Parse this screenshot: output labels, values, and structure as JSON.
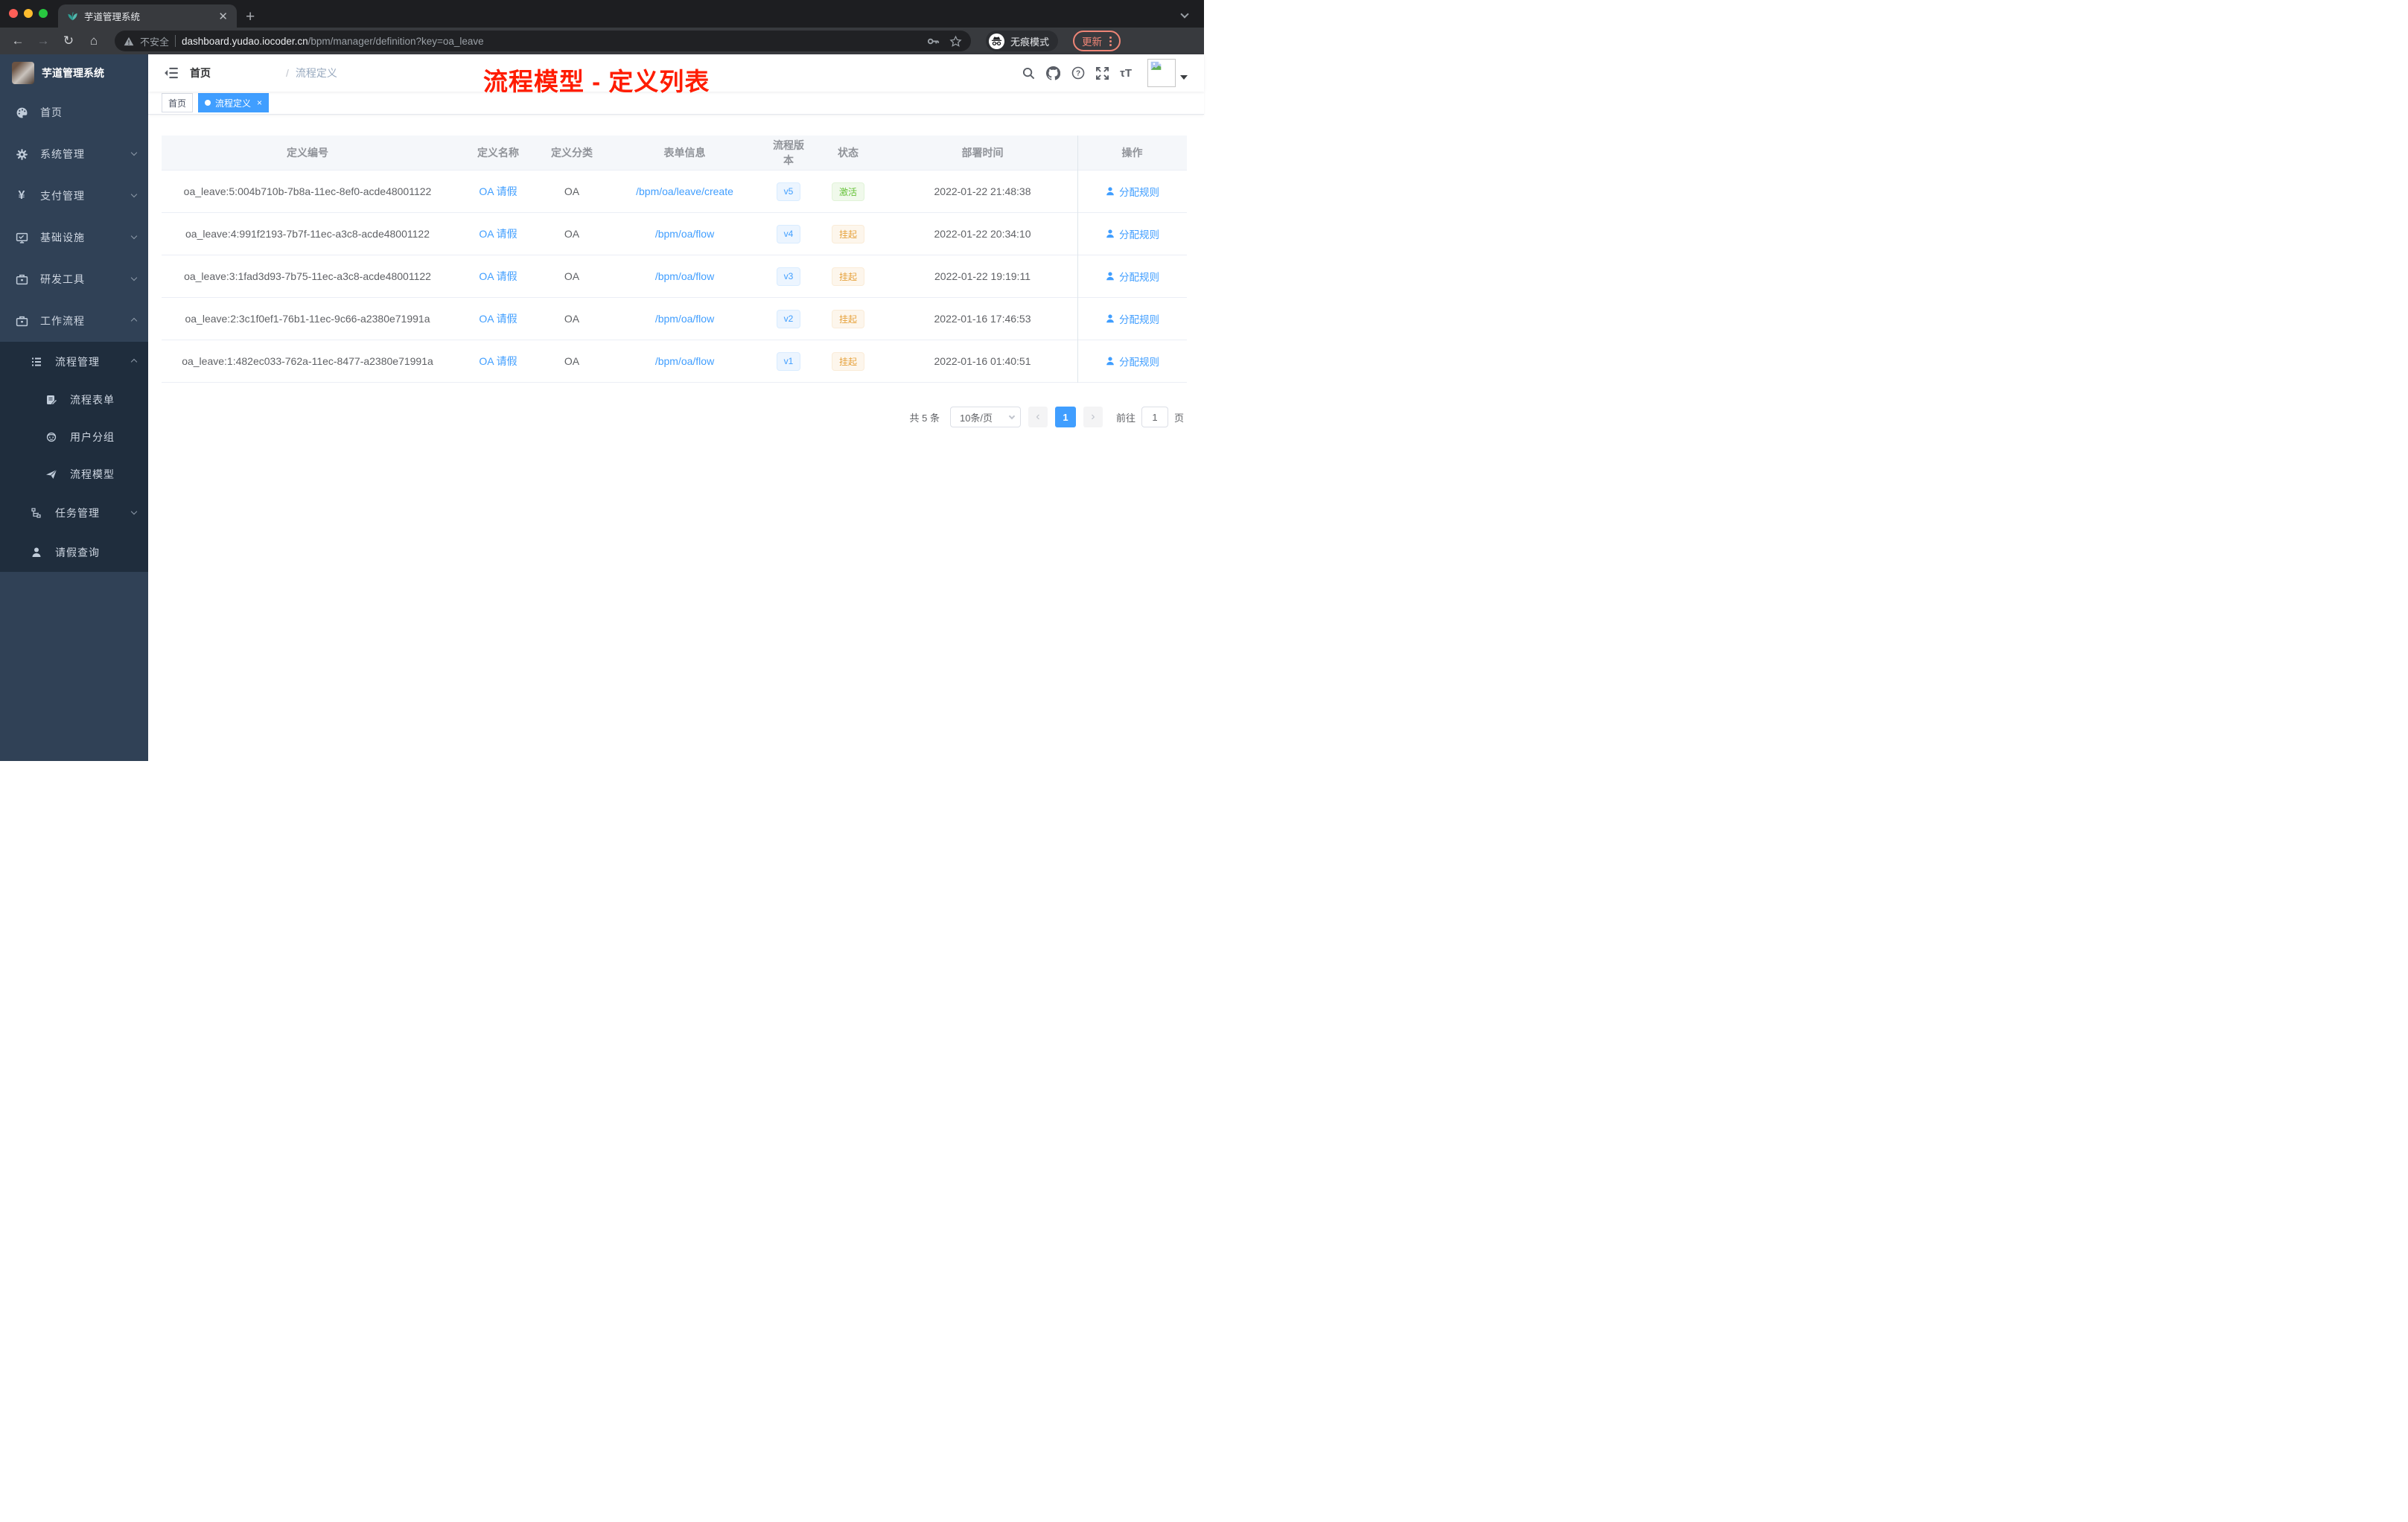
{
  "browser": {
    "tab_title": "芋道管理系统",
    "security_label": "不安全",
    "url_host": "dashboard.yudao.iocoder.cn",
    "url_path": "/bpm/manager/definition?key=oa_leave",
    "incognito_label": "无痕模式",
    "update_label": "更新"
  },
  "sidebar": {
    "logo_title": "芋道管理系统",
    "items": [
      {
        "label": "首页"
      },
      {
        "label": "系统管理"
      },
      {
        "label": "支付管理"
      },
      {
        "label": "基础设施"
      },
      {
        "label": "研发工具"
      },
      {
        "label": "工作流程"
      }
    ],
    "submenu": [
      {
        "label": "流程管理"
      },
      {
        "label": "流程表单"
      },
      {
        "label": "用户分组"
      },
      {
        "label": "流程模型"
      },
      {
        "label": "任务管理"
      },
      {
        "label": "请假查询"
      }
    ]
  },
  "navbar": {
    "breadcrumb": [
      "首页",
      "流程定义"
    ],
    "annotation": "流程模型 - 定义列表"
  },
  "tags": {
    "inactive": "首页",
    "active": "流程定义",
    "close": "×"
  },
  "table": {
    "headers": [
      "定义编号",
      "定义名称",
      "定义分类",
      "表单信息",
      "流程版本",
      "状态",
      "部署时间",
      "操作"
    ],
    "rows": [
      {
        "id": "oa_leave:5:004b710b-7b8a-11ec-8ef0-acde48001122",
        "name": "OA 请假",
        "category": "OA",
        "form": "/bpm/oa/leave/create",
        "version": "v5",
        "status": "激活",
        "status_type": "success",
        "time": "2022-01-22 21:48:38",
        "action": "分配规则"
      },
      {
        "id": "oa_leave:4:991f2193-7b7f-11ec-a3c8-acde48001122",
        "name": "OA 请假",
        "category": "OA",
        "form": "/bpm/oa/flow",
        "version": "v4",
        "status": "挂起",
        "status_type": "warning",
        "time": "2022-01-22 20:34:10",
        "action": "分配规则"
      },
      {
        "id": "oa_leave:3:1fad3d93-7b75-11ec-a3c8-acde48001122",
        "name": "OA 请假",
        "category": "OA",
        "form": "/bpm/oa/flow",
        "version": "v3",
        "status": "挂起",
        "status_type": "warning",
        "time": "2022-01-22 19:19:11",
        "action": "分配规则"
      },
      {
        "id": "oa_leave:2:3c1f0ef1-76b1-11ec-9c66-a2380e71991a",
        "name": "OA 请假",
        "category": "OA",
        "form": "/bpm/oa/flow",
        "version": "v2",
        "status": "挂起",
        "status_type": "warning",
        "time": "2022-01-16 17:46:53",
        "action": "分配规则"
      },
      {
        "id": "oa_leave:1:482ec033-762a-11ec-8477-a2380e71991a",
        "name": "OA 请假",
        "category": "OA",
        "form": "/bpm/oa/flow",
        "version": "v1",
        "status": "挂起",
        "status_type": "warning",
        "time": "2022-01-16 01:40:51",
        "action": "分配规则"
      }
    ]
  },
  "pagination": {
    "total": "共 5 条",
    "page_size": "10条/页",
    "prev": "‹",
    "current_page": "1",
    "next": "›",
    "goto_label": "前往",
    "goto_value": "1",
    "page_label": "页"
  },
  "colors": {
    "accent_blue": "#409eff",
    "success_green": "#67c23a",
    "warning_orange": "#e6a23c",
    "annotation_red": "#ff1c00",
    "sidebar_bg": "#304156",
    "submenu_bg": "#1f2d3d",
    "chrome_update_red": "#ee8576"
  }
}
